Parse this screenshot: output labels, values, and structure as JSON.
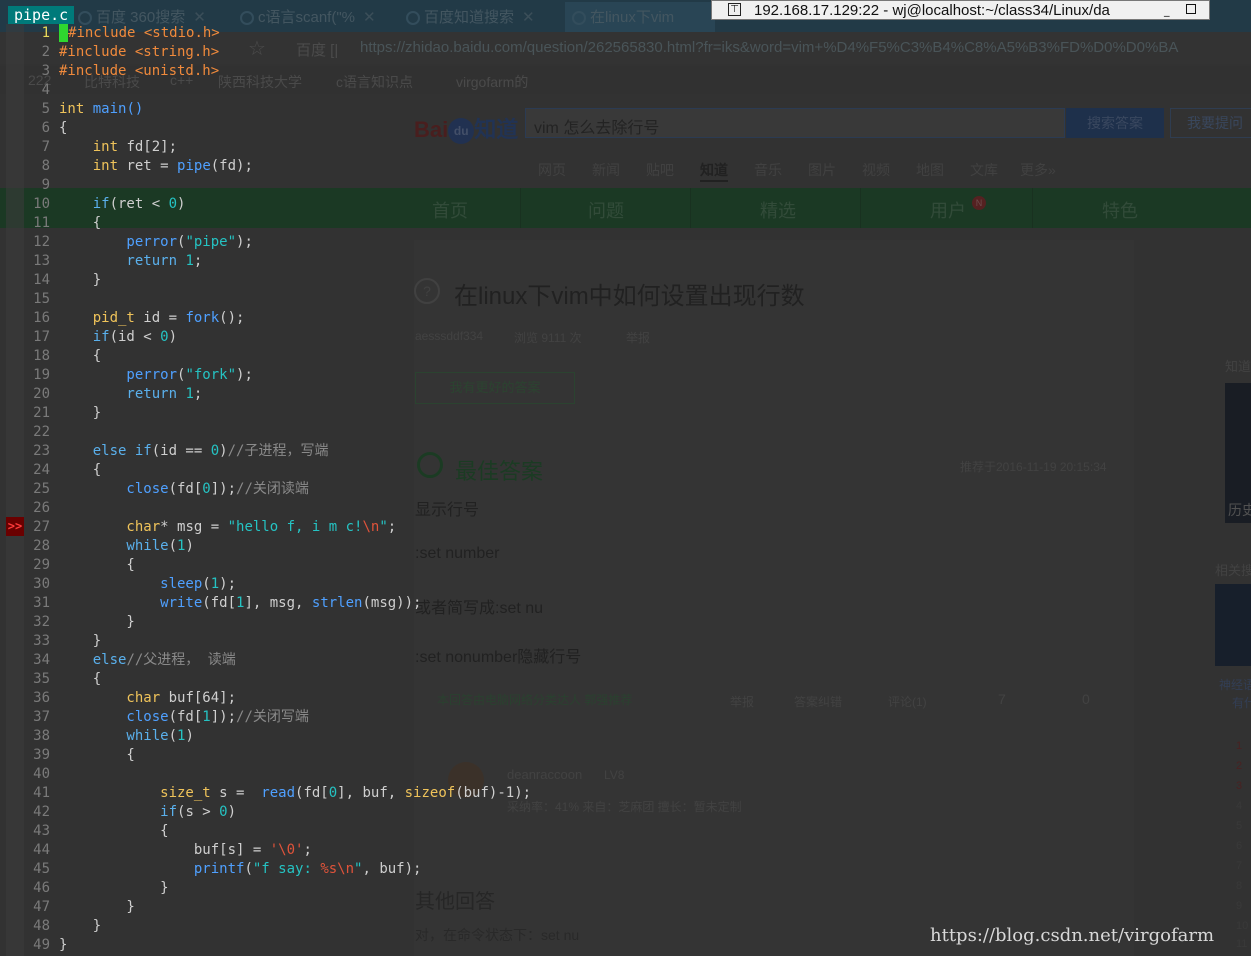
{
  "browser": {
    "tabs": [
      {
        "label": "百度  360搜索"
      },
      {
        "label": "c语言scanf(\"%"
      },
      {
        "label": "百度知道搜索"
      },
      {
        "label": "在linux下vim"
      }
    ],
    "address_prefix": "百度 [|",
    "address_url": "https://zhidao.baidu.com/question/262565830.html?fr=iks&word=vim+%D4%F5%C3%B4%C8%A5%B3%FD%D0%D0%BA",
    "bookmarks": [
      "222",
      "比特科技",
      "c++",
      "陕西科技大学",
      "c语言知识点",
      "virgofarm的"
    ],
    "logo": {
      "bai": "Bai",
      "du": "du",
      "zhidao": "知道"
    },
    "search_value": "vim 怎么去除行号",
    "search_button": "搜索答案",
    "ask_button": "我要提问",
    "nav": [
      "网页",
      "新闻",
      "贴吧",
      "知道",
      "音乐",
      "图片",
      "视频",
      "地图",
      "文库",
      "更多»"
    ],
    "green_nav": [
      "首页",
      "问题",
      "精选",
      "用户",
      "特色"
    ],
    "user_badge": "N",
    "question_icon": "?",
    "question_title": "在linux下vim中如何设置出现行数",
    "question_meta": {
      "author": "aesssddf334",
      "views": "浏览 9111 次",
      "report": "举报"
    },
    "better_answer_button": "我有更好的答案",
    "best_answer_title": "最佳答案",
    "best_answer_time": "推荐于2016-11-19 20:15:34",
    "answer_lines": [
      "显示行号",
      ":set number",
      "或者简写成:set nu",
      ":set nonumber隐藏行号"
    ],
    "answer_footer": {
      "recommend": "本回答由电脑网络分类达人 郭强推荐",
      "report": "举报",
      "correct": "答案纠错",
      "comments": "评论(1)",
      "likes": "7",
      "dislikes": "0"
    },
    "answerer": {
      "name": "deanraccoon",
      "level": "LV8",
      "stats": "采纳率：41%   来自：芝麻团   擅长：暂未定制"
    },
    "other_answers_title": "其他回答",
    "other_answer_first": "对，在命令状态下：set nu",
    "sidebar": {
      "label1": "知道",
      "label2": "相关搜",
      "img_label": "历史",
      "img2_label": "神经语",
      "img2_sub": "有什"
    },
    "ranks": [
      "1",
      "2",
      "3",
      "4",
      "5",
      "6",
      "7",
      "8",
      "9",
      "10",
      "11"
    ]
  },
  "remote_window": {
    "title": "192.168.17.129:22 - wj@localhost:~/class34/Linux/da"
  },
  "vim": {
    "current_tab": "pipe.c",
    "line_numbers": [
      "1",
      "2",
      "3",
      "4",
      "5",
      "6",
      "7",
      "8",
      "9",
      "10",
      "11",
      "12",
      "13",
      "14",
      "15",
      "16",
      "17",
      "18",
      "19",
      "20",
      "21",
      "22",
      "23",
      "24",
      "25",
      "26",
      "27",
      "28",
      "29",
      "30",
      "31",
      "32",
      "33",
      "34",
      "35",
      "36",
      "37",
      "38",
      "39",
      "40",
      "41",
      "42",
      "43",
      "44",
      "45",
      "46",
      "47",
      "48",
      "49"
    ],
    "sign_marker": ">>",
    "code": {
      "l1": "include <stdio.h>",
      "l2": "#include <string.h>",
      "l3": "#include <unistd.h>",
      "l5_type": "int",
      "l5_name": " main()",
      "l6": "{",
      "l7_type": "    int",
      "l7_rest": " fd[2];",
      "l8_type": "    int",
      "l8_mid": " ret = ",
      "l8_fn": "pipe",
      "l8_end": "(fd);",
      "l10_kw": "    if",
      "l10_mid": "(ret < ",
      "l10_num": "0",
      "l10_end": ")",
      "l11": "    {",
      "l12_fn": "        perror",
      "l12_a": "(",
      "l12_str": "\"pipe\"",
      "l12_b": ");",
      "l13_kw": "        return",
      "l13_sp": " ",
      "l13_num": "1",
      "l13_end": ";",
      "l14": "    }",
      "l16_type": "    pid_t",
      "l16_mid": " id = ",
      "l16_fn": "fork",
      "l16_end": "();",
      "l17_kw": "    if",
      "l17_mid": "(id < ",
      "l17_num": "0",
      "l17_end": ")",
      "l18": "    {",
      "l19_fn": "        perror",
      "l19_a": "(",
      "l19_str": "\"fork\"",
      "l19_b": ");",
      "l20_kw": "        return",
      "l20_sp": " ",
      "l20_num": "1",
      "l20_end": ";",
      "l21": "    }",
      "l23_kw": "    else if",
      "l23_mid": "(id == ",
      "l23_num": "0",
      "l23_end": ")",
      "l23_cm": "//子进程，写端",
      "l24": "    {",
      "l25_fn": "        close",
      "l25_a": "(fd[",
      "l25_num": "0",
      "l25_b": "]);",
      "l25_cm": "//关闭读端",
      "l27_type": "        char",
      "l27_mid": "* msg = ",
      "l27_str": "\"hello f, i m c!",
      "l27_esc": "\\n",
      "l27_q": "\"",
      "l27_end": ";",
      "l28_kw": "        while",
      "l28_a": "(",
      "l28_num": "1",
      "l28_b": ")",
      "l29": "        {",
      "l30_fn": "            sleep",
      "l30_a": "(",
      "l30_num": "1",
      "l30_b": ");",
      "l31_fn": "            write",
      "l31_a": "(fd[",
      "l31_num": "1",
      "l31_b": "], msg, ",
      "l31_fn2": "strlen",
      "l31_c": "(msg));",
      "l32": "        }",
      "l33": "    }",
      "l34_kw": "    else",
      "l34_cm": "//父进程， 读端",
      "l35": "    {",
      "l36_type": "        char",
      "l36_rest": " buf[64];",
      "l37_fn": "        close",
      "l37_a": "(fd[",
      "l37_num": "1",
      "l37_b": "]);",
      "l37_cm": "//关闭写端",
      "l38_kw": "        while",
      "l38_a": "(",
      "l38_num": "1",
      "l38_b": ")",
      "l39": "        {",
      "l41_type": "            size_t",
      "l41_mid": " s =  ",
      "l41_fn": "read",
      "l41_a": "(fd[",
      "l41_num": "0",
      "l41_b": "], buf, ",
      "l41_kw": "sizeof",
      "l41_c": "(buf)-1);",
      "l42_kw": "            if",
      "l42_mid": "(s > ",
      "l42_num": "0",
      "l42_end": ")",
      "l43": "            {",
      "l44_mid": "                buf[s] = ",
      "l44_str": "'",
      "l44_esc": "\\0",
      "l44_q": "'",
      "l44_end": ";",
      "l45_fn": "                printf",
      "l45_a": "(",
      "l45_str": "\"f say: ",
      "l45_fmt": "%s\\n",
      "l45_q": "\"",
      "l45_b": ", buf);",
      "l46": "            }",
      "l47": "        }",
      "l48": "    }",
      "l49": "}"
    }
  },
  "watermark": "https://blog.csdn.net/virgofarm"
}
